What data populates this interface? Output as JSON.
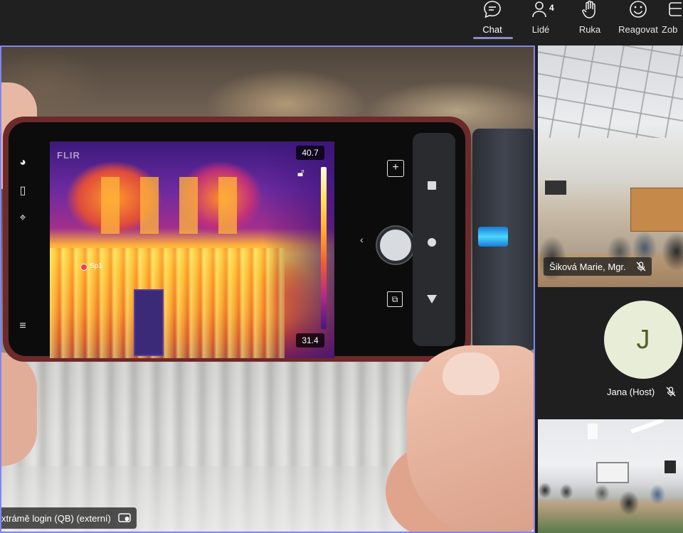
{
  "toolbar": {
    "buttons": [
      {
        "label": "Chat",
        "icon": "chat-icon"
      },
      {
        "label": "Lidé",
        "icon": "people-icon",
        "badge": "4"
      },
      {
        "label": "Ruka",
        "icon": "raise-hand-icon"
      },
      {
        "label": "Reagovat",
        "icon": "react-icon"
      },
      {
        "label": "Zob",
        "icon": "view-icon"
      }
    ],
    "active": "Chat",
    "accent_color": "#7f85f5"
  },
  "main_video": {
    "presenter_label": "xtrámě login (QB) (externí)",
    "thermal": {
      "max_temp": "40.7",
      "min_temp": "31.4",
      "brand": "FLIR",
      "spot_label": "Sp1"
    }
  },
  "participants": [
    {
      "name": "Šiková Marie, Mgr.",
      "muted": true,
      "type": "video"
    },
    {
      "name": "Jana (Host)",
      "initial": "J",
      "muted": true,
      "type": "avatar",
      "avatar_color": "#e8edd8"
    },
    {
      "name": "",
      "muted": false,
      "type": "video"
    }
  ]
}
